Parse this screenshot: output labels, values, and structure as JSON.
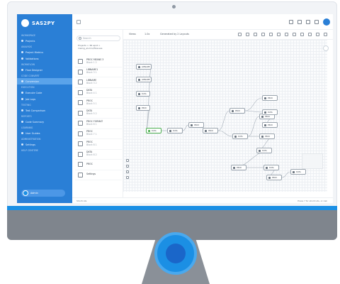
{
  "brand": {
    "name": "SAS2PY"
  },
  "sidebar": {
    "sections": [
      {
        "title": "WORKSPACE",
        "items": [
          {
            "label": "Projects",
            "icon": "folder-icon"
          }
        ]
      },
      {
        "title": "ANALYSIS",
        "items": [
          {
            "label": "Project Metrics",
            "icon": "chart-icon"
          },
          {
            "label": "Validations",
            "icon": "check-icon"
          }
        ]
      },
      {
        "title": "WORKFLOW",
        "items": [
          {
            "label": "Flow Designer",
            "icon": "flow-icon"
          }
        ]
      },
      {
        "title": "CODE CONVERT",
        "items": [
          {
            "label": "Conversion",
            "icon": "convert-icon",
            "active": true
          }
        ]
      },
      {
        "title": "EXECUTION",
        "items": [
          {
            "label": "Execute Code",
            "icon": "play-icon"
          },
          {
            "label": "Job Logs",
            "icon": "log-icon"
          }
        ]
      },
      {
        "title": "TESTING",
        "items": [
          {
            "label": "Test Comparison",
            "icon": "compare-icon"
          }
        ]
      },
      {
        "title": "REPORTS",
        "items": [
          {
            "label": "Code Summary",
            "icon": "summary-icon"
          }
        ]
      },
      {
        "title": "LEARNING",
        "items": [
          {
            "label": "User Guides",
            "icon": "book-icon"
          }
        ]
      },
      {
        "title": "ADMINISTRATION",
        "items": [
          {
            "label": "Settings",
            "icon": "gear-icon"
          }
        ]
      },
      {
        "title": "HELP CENTERE",
        "items": []
      }
    ],
    "user": {
      "name": "Admin"
    }
  },
  "blocks_panel": {
    "search_placeholder": "Search",
    "subtitle": "Projects > 3R epot > inwing_alumni/flow.sas",
    "items": [
      {
        "label": "PROC MEANS 3",
        "sub": "Block 1 2"
      },
      {
        "label": "LIBNAME1",
        "sub": "Block 3 1"
      },
      {
        "label": "LIBNAME",
        "sub": "Block 3 2"
      },
      {
        "label": "DATA",
        "sub": "Block 4 1"
      },
      {
        "label": "PROC",
        "sub": "Block 5 1"
      },
      {
        "label": "DATA",
        "sub": "Block 5 2"
      },
      {
        "label": "PROC FORMAT",
        "sub": "Block 6 1"
      },
      {
        "label": "PROC",
        "sub": "Block 7 1"
      },
      {
        "label": "PROC",
        "sub": "Block 8 1"
      },
      {
        "label": "DATA",
        "sub": "Block 8 2"
      },
      {
        "label": "PROC",
        "sub": ""
      },
      {
        "label": "Settings",
        "sub": ""
      }
    ]
  },
  "canvas_toolbar": {
    "view_label": "Views",
    "zoom_label": "1.0x",
    "layout_label": "Generated by 2 Layouts"
  },
  "nodes": [
    {
      "label": "LIBNAME",
      "color": "gray"
    },
    {
      "label": "LIBNAME",
      "color": "gray"
    },
    {
      "label": "DATA",
      "color": "gray"
    },
    {
      "label": "PROC",
      "color": "gray"
    },
    {
      "label": "DATA",
      "color": "green"
    },
    {
      "label": "DATA",
      "color": "gray"
    },
    {
      "label": "PROC",
      "color": "gray"
    },
    {
      "label": "PROC",
      "color": "gray"
    },
    {
      "label": "PROC",
      "color": "gray"
    },
    {
      "label": "DATA",
      "color": "gray"
    },
    {
      "label": "PROC",
      "color": "gray"
    },
    {
      "label": "PROC",
      "color": "gray"
    },
    {
      "label": "DATA",
      "color": "gray"
    },
    {
      "label": "PROC",
      "color": "gray"
    },
    {
      "label": "DATA",
      "color": "gray"
    },
    {
      "label": "PROC",
      "color": "gray"
    },
    {
      "label": "PROC",
      "color": "gray"
    },
    {
      "label": "DATA",
      "color": "gray"
    },
    {
      "label": "PROC",
      "color": "gray"
    },
    {
      "label": "DATA",
      "color": "gray"
    }
  ],
  "status": {
    "left": "Shortcuts",
    "right": "Press ? for shortcuts, or Ask"
  },
  "colors": {
    "brand_blue": "#2a7fd6",
    "accent": "#1b8fe4",
    "node_green": "#4caf50"
  }
}
